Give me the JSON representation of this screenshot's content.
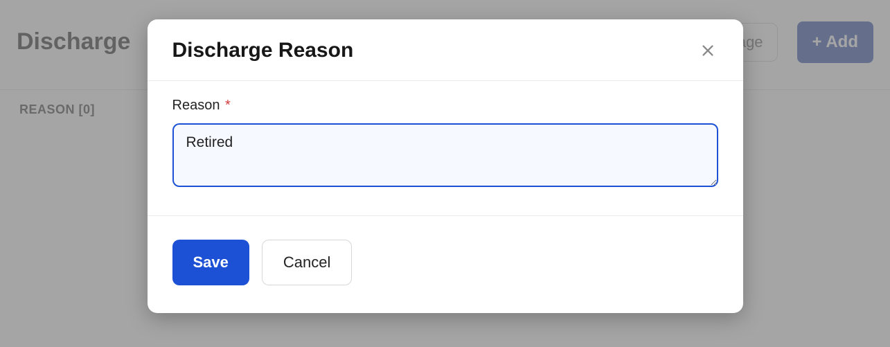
{
  "page": {
    "title": "Discharge",
    "search_placeholder": "ne page",
    "add_button": "+ Add",
    "column_header": "REASON [0]"
  },
  "modal": {
    "title": "Discharge Reason",
    "field_label": "Reason",
    "required_mark": "*",
    "reason_value": "Retired",
    "save_label": "Save",
    "cancel_label": "Cancel"
  }
}
